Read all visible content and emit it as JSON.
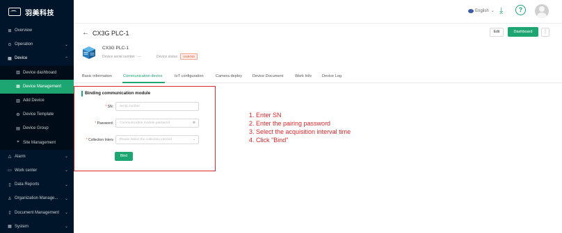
{
  "app": {
    "name": "羽美科技"
  },
  "sidebar": {
    "items": [
      {
        "icon": "⊞",
        "label": "Overview",
        "chevron": ""
      },
      {
        "icon": "⊙",
        "label": "Operation",
        "chevron": "⌄"
      },
      {
        "icon": "▦",
        "label": "Device",
        "chevron": "⌃"
      },
      {
        "icon": "▥",
        "label": "Device dashboard",
        "chevron": ""
      },
      {
        "icon": "▦",
        "label": "Device Management",
        "chevron": ""
      },
      {
        "icon": "▥",
        "label": "Add Device",
        "chevron": ""
      },
      {
        "icon": "⚙",
        "label": "Device Template",
        "chevron": ""
      },
      {
        "icon": "▤",
        "label": "Device Group",
        "chevron": ""
      },
      {
        "icon": "⌖",
        "label": "Site Management",
        "chevron": ""
      },
      {
        "icon": "△",
        "label": "Alarm",
        "chevron": "⌄"
      },
      {
        "icon": "▭",
        "label": "Work center",
        "chevron": "⌄"
      },
      {
        "icon": "▯",
        "label": "Data Reports",
        "chevron": "⌄"
      },
      {
        "icon": "♙",
        "label": "Organization Manage...",
        "chevron": "⌄"
      },
      {
        "icon": "▯",
        "label": "Document Management",
        "chevron": "⌄"
      },
      {
        "icon": "▦",
        "label": "System",
        "chevron": "⌄"
      }
    ]
  },
  "header": {
    "language": "English",
    "language_chevron": "⌄",
    "download_glyph": "⤓",
    "help_glyph": "?"
  },
  "page": {
    "back_glyph": "←",
    "title": "CX3G PLC-1",
    "edit_label": "Edit",
    "dashboard_label": "Dashboard",
    "more_label": "⋮",
    "device_name": "CX3G PLC-1",
    "serial_label": "Device serial number : ---",
    "status_label": "Device status :",
    "status_value": "UNBIND"
  },
  "tabs": [
    "Basic information",
    "Communication device",
    "IoT configuration",
    "Camera deploy",
    "Device Document",
    "Work Info",
    "Device Log"
  ],
  "binding": {
    "title": "Binding communication module",
    "sn_label": "SN:",
    "sn_placeholder": "serial number",
    "password_label": "Password:",
    "password_placeholder": "Communication module password",
    "password_icon": "⊗",
    "interval_label": "Collection Interv",
    "interval_placeholder": "Please select the collection interval",
    "interval_chevron": "⌄",
    "required_mark": "*",
    "bind_label": "Bind"
  },
  "instructions": [
    "1. Enter SN",
    "2. Enter the pairing password",
    "3. Select the acquisition interval time",
    "4. Click \"Bind\""
  ],
  "colors": {
    "accent": "#1ea672",
    "sidebar_bg": "#001529",
    "highlight": "#d9272c",
    "status": "#e8572f"
  }
}
